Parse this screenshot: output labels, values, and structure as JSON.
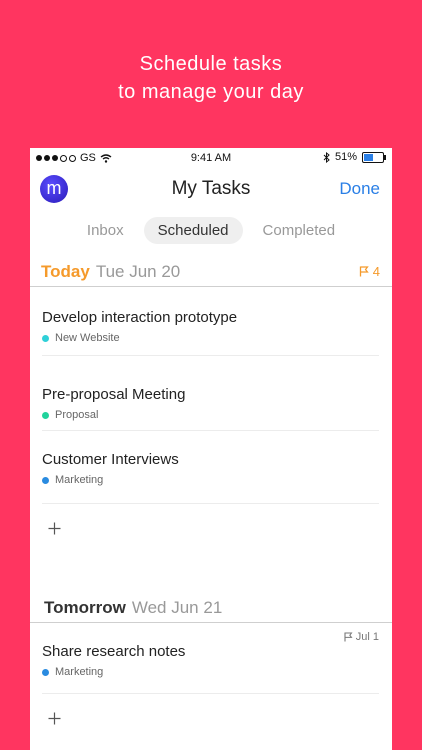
{
  "headline": {
    "line1": "Schedule tasks",
    "line2": "to manage your day"
  },
  "status": {
    "carrier": "GS",
    "time": "9:41 AM",
    "battery": "51%",
    "battery_level": 0.51
  },
  "nav": {
    "avatar_letter": "m",
    "title": "My Tasks",
    "done_label": "Done"
  },
  "tabs": [
    {
      "label": "Inbox"
    },
    {
      "label": "Scheduled"
    },
    {
      "label": "Completed"
    }
  ],
  "sections": [
    {
      "name": "Today",
      "date": "Tue Jun 20",
      "count": "4",
      "tasks": [
        {
          "title": "Develop interaction prototype",
          "project": "New Website",
          "color": "#2fd0d8"
        },
        {
          "title": "Pre-proposal Meeting",
          "project": "Proposal",
          "color": "#21d39c"
        },
        {
          "title": "Customer Interviews",
          "project": "Marketing",
          "color": "#2a8be0"
        }
      ]
    },
    {
      "name": "Tomorrow",
      "date": "Wed Jun 21",
      "tasks": [
        {
          "title": "Share research notes",
          "project": "Marketing",
          "color": "#2a8be0",
          "due": "Jul 1"
        }
      ]
    }
  ],
  "colors": {
    "background": "#ff3560",
    "accent": "#2a7fe6",
    "today": "#f59a2b"
  }
}
